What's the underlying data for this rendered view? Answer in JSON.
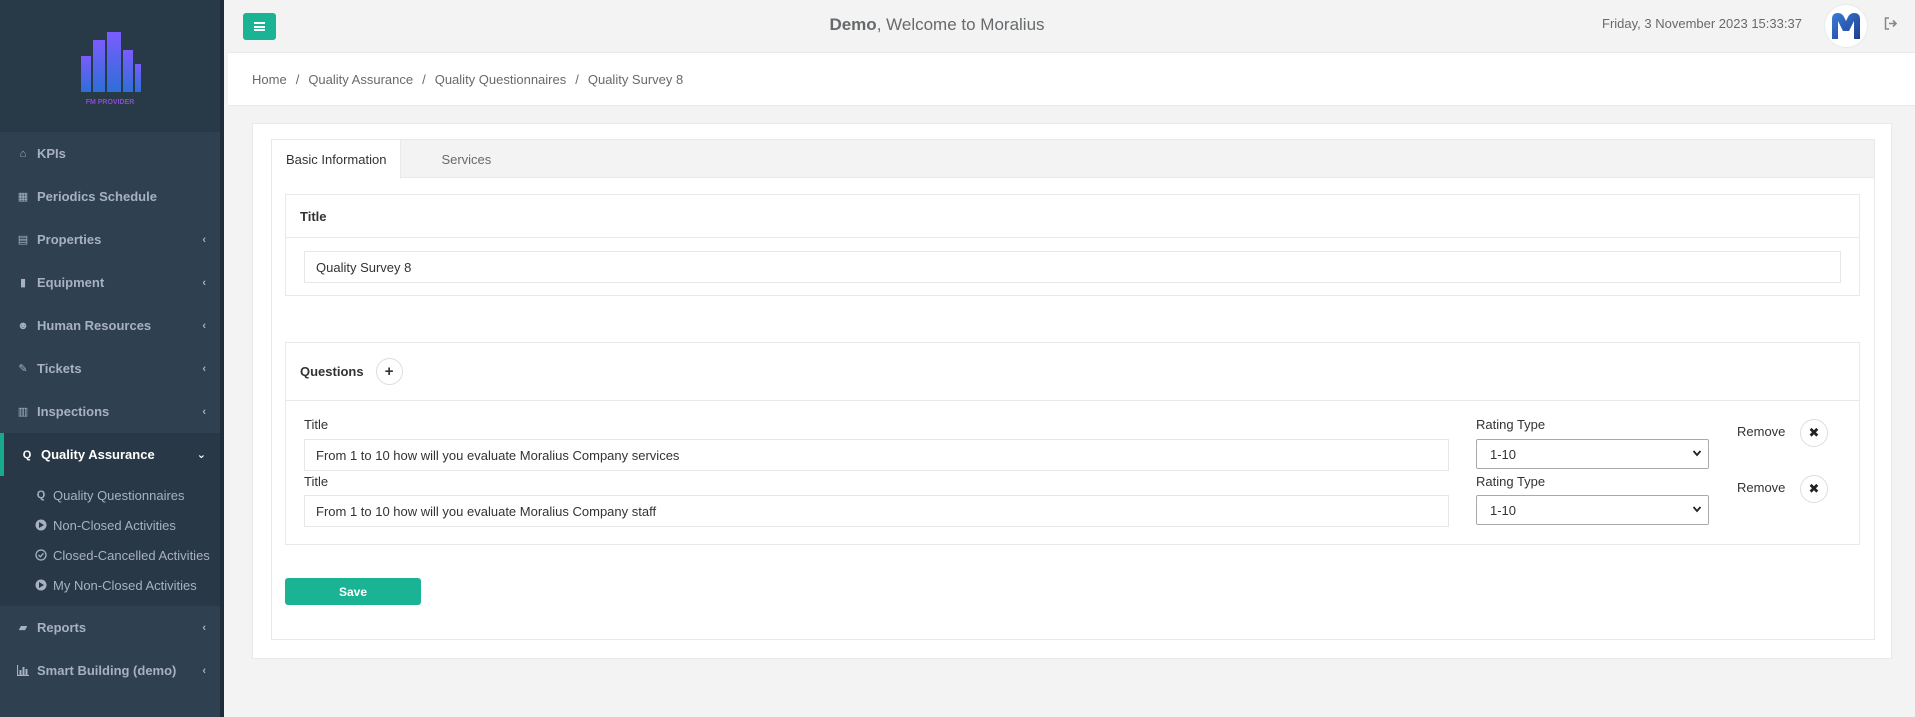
{
  "header": {
    "welcome_name": "Demo",
    "welcome_rest": ", Welcome to Moralius",
    "datetime": "Friday, 3 November 2023 15:33:37"
  },
  "logo": {
    "text": "FM PROVIDER"
  },
  "sidebar": {
    "items": [
      {
        "label": "KPIs",
        "icon": "home-icon",
        "chevron": false
      },
      {
        "label": "Periodics Schedule",
        "icon": "calendar-icon",
        "chevron": false
      },
      {
        "label": "Properties",
        "icon": "building-icon",
        "chevron": true
      },
      {
        "label": "Equipment",
        "icon": "clipboard-icon",
        "chevron": true
      },
      {
        "label": "Human Resources",
        "icon": "users-icon",
        "chevron": true
      },
      {
        "label": "Tickets",
        "icon": "pen-icon",
        "chevron": true
      },
      {
        "label": "Inspections",
        "icon": "map-icon",
        "chevron": true
      },
      {
        "label": "Quality Assurance",
        "icon": "q-icon",
        "chevron": true,
        "active": true
      },
      {
        "label": "Reports",
        "icon": "book-icon",
        "chevron": true
      },
      {
        "label": "Smart Building (demo)",
        "icon": "bar-chart-icon",
        "chevron": true
      }
    ],
    "subitems": [
      {
        "label": "Quality Questionnaires",
        "icon": "q-icon"
      },
      {
        "label": "Non-Closed Activities",
        "icon": "arrow-circle-icon"
      },
      {
        "label": "Closed-Cancelled Activities",
        "icon": "check-circle-icon"
      },
      {
        "label": "My Non-Closed Activities",
        "icon": "arrow-circle-icon"
      }
    ]
  },
  "breadcrumb": [
    "Home",
    "Quality Assurance",
    "Quality Questionnaires",
    "Quality Survey 8"
  ],
  "tabs": [
    "Basic Information",
    "Services"
  ],
  "title_section": {
    "heading": "Title",
    "value": "Quality Survey 8"
  },
  "questions_section": {
    "heading": "Questions",
    "add_symbol": "+",
    "questions": [
      {
        "title_label": "Title",
        "title_value": "From 1 to 10 how will you evaluate Moralius Company services",
        "rating_label": "Rating Type",
        "rating_value": "1-10",
        "remove_label": "Remove"
      },
      {
        "title_label": "Title",
        "title_value": "From 1 to 10 how will you evaluate Moralius Company staff",
        "rating_label": "Rating Type",
        "rating_value": "1-10",
        "remove_label": "Remove"
      }
    ]
  },
  "save_label": "Save",
  "colors": {
    "sidebar": "#2f4050",
    "accent": "#1ab394",
    "background": "#f3f3f4"
  }
}
